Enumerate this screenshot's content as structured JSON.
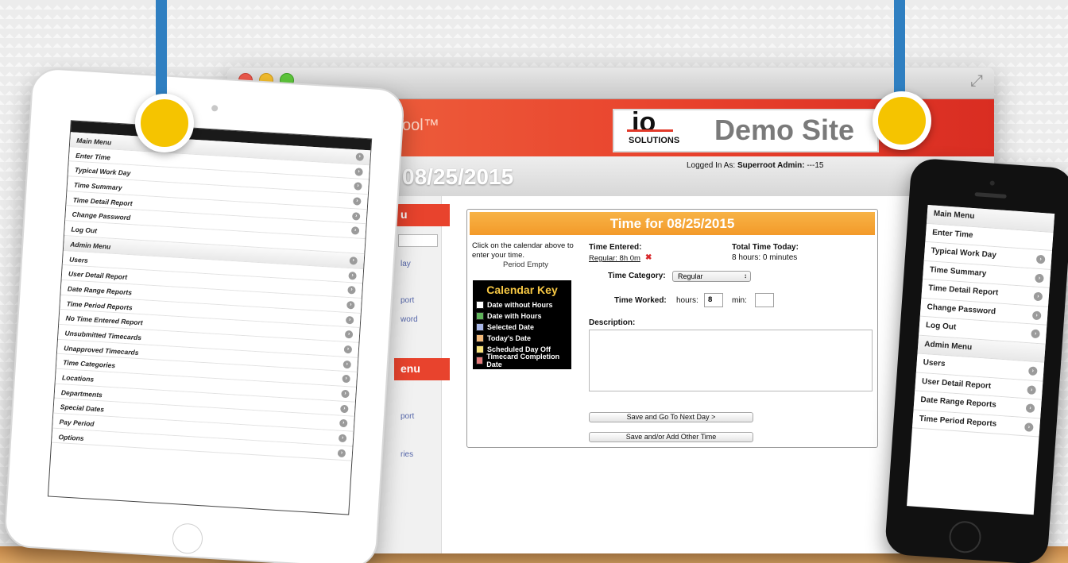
{
  "browser": {
    "product_fragment": "Tool™",
    "logo": {
      "big": "io",
      "sub": "SOLUTIONS"
    },
    "site_name": "Demo Site",
    "date_heading": "08/25/2015",
    "logged_in_prefix": "Logged In As:",
    "logged_in_user": "Superroot Admin:",
    "logged_in_suffix": " ---15",
    "sidebar": {
      "header_1": "u",
      "header_2": "enu",
      "link_fragments": [
        "lay",
        "port",
        "word",
        "port",
        "ries"
      ]
    },
    "panel": {
      "title": "Time for 08/25/2015",
      "instruction": "Click on the calendar above to enter your time.",
      "period": "Period Empty",
      "calendar_key": {
        "title": "Calendar Key",
        "items": [
          {
            "label": "Date without Hours",
            "color": "#ffffff"
          },
          {
            "label": "Date with Hours",
            "color": "#5fb35a"
          },
          {
            "label": "Selected Date",
            "color": "#a9b7e8"
          },
          {
            "label": "Today's Date",
            "color": "#f3b97a"
          },
          {
            "label": "Scheduled Day Off",
            "color": "#f8e27a"
          },
          {
            "label": "Timecard Completion Date",
            "color": "#e47a7a"
          }
        ]
      },
      "time_entered_label": "Time Entered:",
      "time_entered_value": "Regular: 8h 0m",
      "total_label": "Total Time Today:",
      "total_value": "8 hours: 0 minutes",
      "category_label": "Time Category:",
      "category_value": "Regular",
      "worked_label": "Time Worked:",
      "hours_label": "hours:",
      "hours_value": "8",
      "min_label": "min:",
      "min_value": "",
      "description_label": "Description:",
      "description_value": "",
      "btn_next": "Save and Go To Next Day >",
      "btn_add": "Save and/or Add Other Time"
    }
  },
  "ipad_menu": [
    {
      "label": "Main Menu",
      "header": true,
      "chevron": true
    },
    {
      "label": "Enter Time",
      "header": false,
      "chevron": true
    },
    {
      "label": "Typical Work Day",
      "header": false,
      "chevron": true
    },
    {
      "label": "Time Summary",
      "header": false,
      "chevron": true
    },
    {
      "label": "Time Detail Report",
      "header": false,
      "chevron": true
    },
    {
      "label": "Change Password",
      "header": false,
      "chevron": true
    },
    {
      "label": "Log Out",
      "header": false,
      "chevron": false
    },
    {
      "label": "Admin Menu",
      "header": true,
      "chevron": true
    },
    {
      "label": "Users",
      "header": false,
      "chevron": true
    },
    {
      "label": "User Detail Report",
      "header": false,
      "chevron": true
    },
    {
      "label": "Date Range Reports",
      "header": false,
      "chevron": true
    },
    {
      "label": "Time Period Reports",
      "header": false,
      "chevron": true
    },
    {
      "label": "No Time Entered Report",
      "header": false,
      "chevron": true
    },
    {
      "label": "Unsubmitted Timecards",
      "header": false,
      "chevron": true
    },
    {
      "label": "Unapproved Timecards",
      "header": false,
      "chevron": true
    },
    {
      "label": "Time Categories",
      "header": false,
      "chevron": true
    },
    {
      "label": "Locations",
      "header": false,
      "chevron": true
    },
    {
      "label": "Departments",
      "header": false,
      "chevron": true
    },
    {
      "label": "Special Dates",
      "header": false,
      "chevron": true
    },
    {
      "label": "Pay Period",
      "header": false,
      "chevron": true
    },
    {
      "label": "Options",
      "header": false,
      "chevron": true
    }
  ],
  "iphone_menu": [
    {
      "label": "Main Menu",
      "header": true,
      "chevron": false
    },
    {
      "label": "Enter Time",
      "header": false,
      "chevron": false
    },
    {
      "label": "Typical Work Day",
      "header": false,
      "chevron": true
    },
    {
      "label": "Time Summary",
      "header": false,
      "chevron": true
    },
    {
      "label": "Time Detail Report",
      "header": false,
      "chevron": true
    },
    {
      "label": "Change Password",
      "header": false,
      "chevron": true
    },
    {
      "label": "Log Out",
      "header": false,
      "chevron": true
    },
    {
      "label": "Admin Menu",
      "header": true,
      "chevron": false
    },
    {
      "label": "Users",
      "header": false,
      "chevron": true
    },
    {
      "label": "User Detail Report",
      "header": false,
      "chevron": true
    },
    {
      "label": "Date Range Reports",
      "header": false,
      "chevron": true
    },
    {
      "label": "Time Period Reports",
      "header": false,
      "chevron": true
    }
  ],
  "icons": {
    "remove": "✖",
    "chevron": "›",
    "select_arrow": "↕",
    "expand": "⤢"
  },
  "colors": {
    "accent_red": "#e8412c",
    "accent_orange": "#f39a2a",
    "pin_blue": "#2f7fc1",
    "pin_yellow": "#f5c400"
  }
}
